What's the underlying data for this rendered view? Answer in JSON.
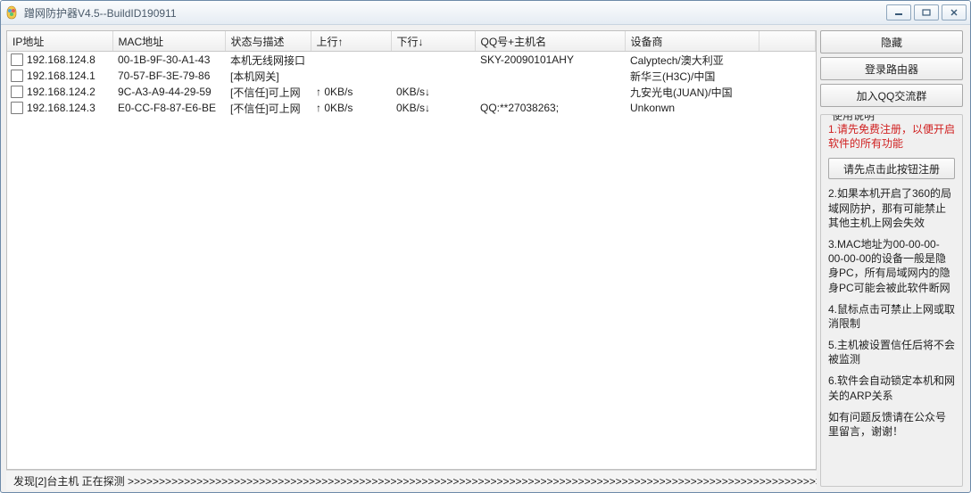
{
  "window": {
    "title": "蹭网防护器V4.5--BuildID190911"
  },
  "columns": {
    "ip": "IP地址",
    "mac": "MAC地址",
    "state": "状态与描述",
    "up": "上行↑",
    "down": "下行↓",
    "qq": "QQ号+主机名",
    "vendor": "设备商",
    "extra": ""
  },
  "rows": [
    {
      "ip": "192.168.124.8",
      "mac": "00-1B-9F-30-A1-43",
      "state": "本机无线网接口",
      "up_arrow": "",
      "up": "",
      "down": "",
      "down_arrow": "",
      "qq": "SKY-20090101AHY",
      "vendor": "Calyptech/澳大利亚"
    },
    {
      "ip": "192.168.124.1",
      "mac": "70-57-BF-3E-79-86",
      "state": "[本机网关]",
      "up_arrow": "",
      "up": "",
      "down": "",
      "down_arrow": "",
      "qq": "",
      "vendor": "新华三(H3C)/中国"
    },
    {
      "ip": "192.168.124.2",
      "mac": "9C-A3-A9-44-29-59",
      "state": "[不信任]可上网",
      "up_arrow": "↑",
      "up": "0KB/s",
      "down": "0KB/s",
      "down_arrow": "↓",
      "qq": "",
      "vendor": "九安光电(JUAN)/中国"
    },
    {
      "ip": "192.168.124.3",
      "mac": "E0-CC-F8-87-E6-BE",
      "state": "[不信任]可上网",
      "up_arrow": "↑",
      "up": "0KB/s",
      "down": "0KB/s",
      "down_arrow": "↓",
      "qq": "QQ:**27038263;",
      "vendor": "Unkonwn"
    }
  ],
  "side": {
    "hide": "隐藏",
    "router": "登录路由器",
    "qqgroup": "加入QQ交流群",
    "legend": "使用说明",
    "tip1": "1.请先免费注册，以便开启软件的所有功能",
    "regbtn": "请先点击此按钮注册",
    "tip2": "2.如果本机开启了360的局域网防护，那有可能禁止其他主机上网会失效",
    "tip3": "3.MAC地址为00-00-00-00-00-00的设备一般是隐身PC，所有局域网内的隐身PC可能会被此软件断网",
    "tip4": "4.鼠标点击可禁止上网或取消限制",
    "tip5": "5.主机被设置信任后将不会被监测",
    "tip6": "6.软件会自动锁定本机和网关的ARP关系",
    "footer": "如有问题反馈请在公众号里留言，谢谢！"
  },
  "status": {
    "text": "发现[2]台主机   正在探测 >>>>>>>>>>>>>>>>>>>>>>>>>>>>>>>>>>>>>>>>>>>>>>>>>>>>>>>>>>>>>>>>>>>>>>>>>>>>>>>>>>>>>>>>>>>>>>>>>>>>>>>>>>>>>>>>"
  }
}
